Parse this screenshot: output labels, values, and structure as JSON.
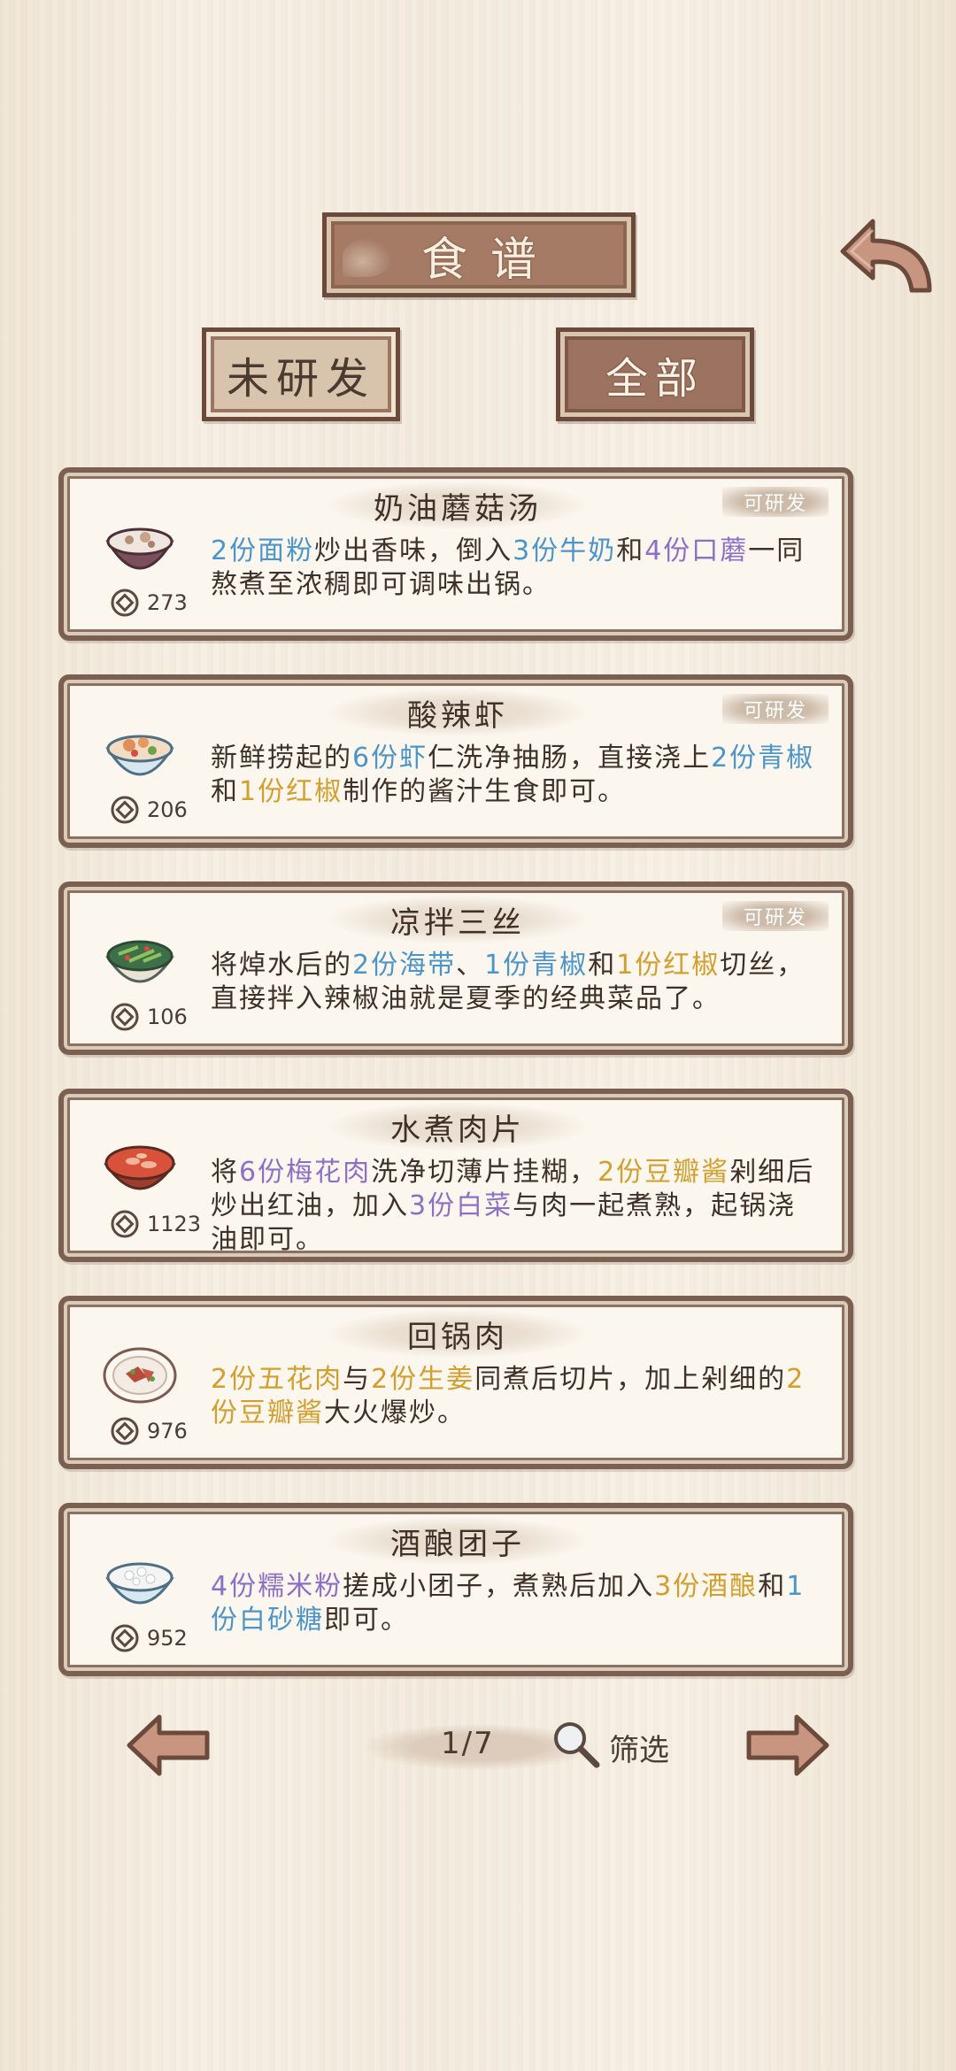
{
  "header": {
    "title": "食谱",
    "back_icon": "back-arrow-icon"
  },
  "tabs": [
    {
      "label": "未研发",
      "selected": false
    },
    {
      "label": "全部",
      "selected": true
    }
  ],
  "recipes": [
    {
      "name": "奶油蘑菇汤",
      "badge": "可研发",
      "price": "273",
      "icon": "mushroom-soup-icon",
      "desc": [
        {
          "t": "2份面粉",
          "c": "blue"
        },
        {
          "t": "炒出香味，倒入"
        },
        {
          "t": "3份牛奶",
          "c": "blue"
        },
        {
          "t": "和"
        },
        {
          "t": "4份口蘑",
          "c": "purple"
        },
        {
          "t": "一同熬煮至浓稠即可调味出锅。"
        }
      ]
    },
    {
      "name": "酸辣虾",
      "badge": "可研发",
      "price": "206",
      "icon": "spicy-shrimp-icon",
      "desc": [
        {
          "t": "新鲜捞起的"
        },
        {
          "t": "6份虾",
          "c": "blue"
        },
        {
          "t": "仁洗净抽肠，直接浇上"
        },
        {
          "t": "2份青椒",
          "c": "blue"
        },
        {
          "t": "和"
        },
        {
          "t": "1份红椒",
          "c": "gold"
        },
        {
          "t": "制作的酱汁生食即可。"
        }
      ]
    },
    {
      "name": "凉拌三丝",
      "badge": "可研发",
      "price": "106",
      "icon": "cold-salad-icon",
      "desc": [
        {
          "t": "将焯水后的"
        },
        {
          "t": "2份海带",
          "c": "blue"
        },
        {
          "t": "、"
        },
        {
          "t": "1份青椒",
          "c": "blue"
        },
        {
          "t": "和"
        },
        {
          "t": "1份红椒",
          "c": "gold"
        },
        {
          "t": "切丝，直接拌入辣椒油就是夏季的经典菜品了。"
        }
      ]
    },
    {
      "name": "水煮肉片",
      "badge": "",
      "price": "1123",
      "icon": "boiled-pork-icon",
      "desc": [
        {
          "t": "将"
        },
        {
          "t": "6份梅花肉",
          "c": "purple"
        },
        {
          "t": "洗净切薄片挂糊，"
        },
        {
          "t": "2份豆瓣酱",
          "c": "gold"
        },
        {
          "t": "剁细后炒出红油，加入"
        },
        {
          "t": "3份白菜",
          "c": "purple"
        },
        {
          "t": "与肉一起煮熟，起锅浇油即可。"
        }
      ]
    },
    {
      "name": "回锅肉",
      "badge": "",
      "price": "976",
      "icon": "twice-cooked-pork-icon",
      "desc": [
        {
          "t": "2份五花肉",
          "c": "gold"
        },
        {
          "t": "与"
        },
        {
          "t": "2份生姜",
          "c": "gold"
        },
        {
          "t": "同煮后切片，加上剁细的"
        },
        {
          "t": "2份豆瓣酱",
          "c": "gold"
        },
        {
          "t": "大火爆炒。"
        }
      ]
    },
    {
      "name": "酒酿团子",
      "badge": "",
      "price": "952",
      "icon": "rice-dumpling-icon",
      "desc": [
        {
          "t": "4份糯米粉",
          "c": "purple"
        },
        {
          "t": "搓成小团子，煮熟后加入"
        },
        {
          "t": "3份酒酿",
          "c": "gold"
        },
        {
          "t": "和"
        },
        {
          "t": "1份白砂糖",
          "c": "blue"
        },
        {
          "t": "即可。"
        }
      ]
    }
  ],
  "pager": {
    "page": "1/7",
    "filter_label": "筛选"
  },
  "colors": {
    "blue": "#4c95c9",
    "purple": "#8c70c6",
    "gold": "#d29f2e",
    "frame": "#6b4a3c",
    "plaque": "#a57b66"
  }
}
